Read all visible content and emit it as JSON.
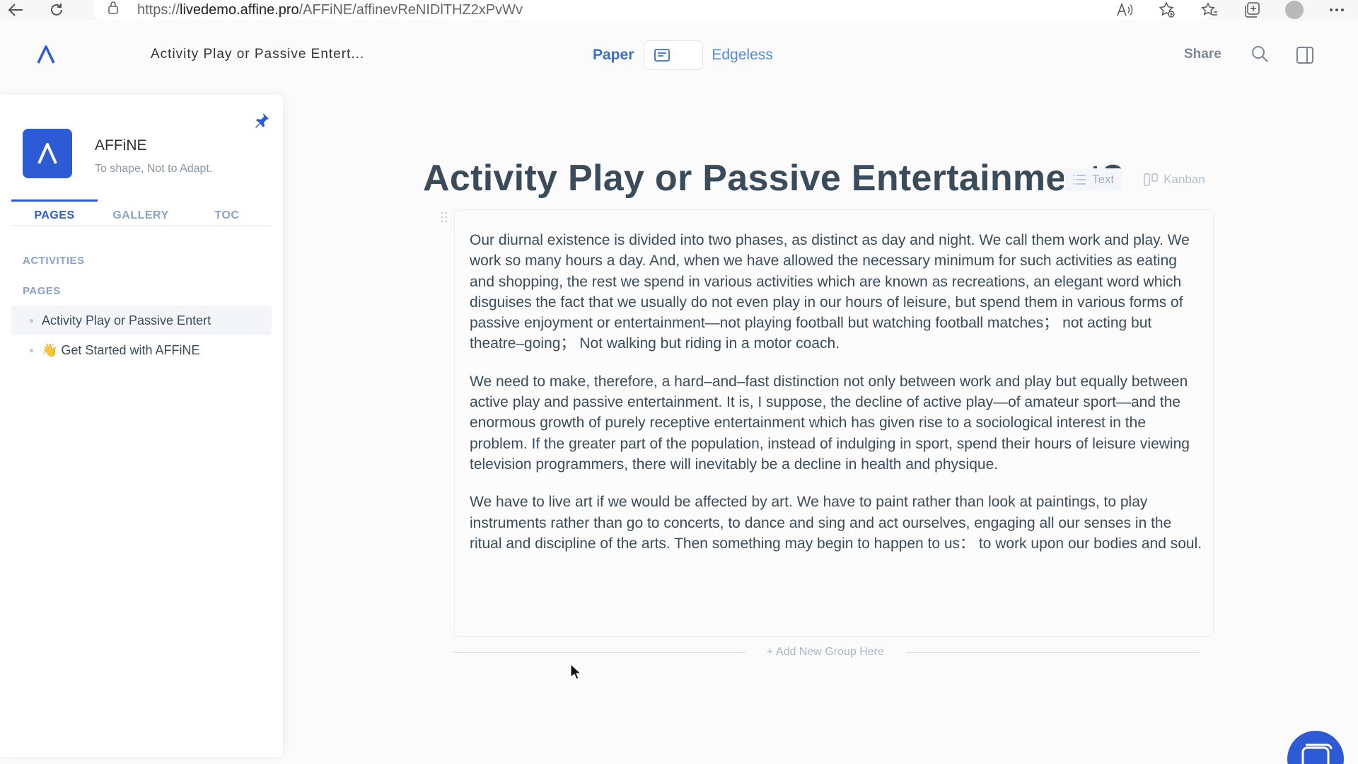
{
  "browser": {
    "url_prefix": "https://",
    "url_domain": "livedemo.affine.pro",
    "url_path": "/AFFiNE/affinevReNIDlTHZ2xPvWv"
  },
  "header": {
    "doc_title_short": "Activity Play or Passive Entert...",
    "mode_paper": "Paper",
    "mode_edgeless": "Edgeless",
    "share": "Share"
  },
  "sidebar": {
    "workspace_name": "AFFiNE",
    "workspace_tagline": "To shape, Not to Adapt.",
    "tabs": [
      {
        "label": "PAGES"
      },
      {
        "label": "GALLERY"
      },
      {
        "label": "TOC"
      }
    ],
    "section_activities": "ACTIVITIES",
    "section_pages": "PAGES",
    "pages": [
      {
        "label": "Activity Play or Passive Entert"
      },
      {
        "label": "👋 Get Started with AFFiNE"
      }
    ]
  },
  "document": {
    "title": "Activity Play or Passive Entertainment?",
    "view_text": "Text",
    "view_kanban": "Kanban",
    "paragraphs": [
      "Our diurnal existence is divided into two phases, as distinct as day and night. We call them work and play. We work so many hours a day. And, when we have allowed the necessary minimum for such activities as eating and shopping, the rest we spend in various activities which are known as recreations, an elegant word which disguises the fact that we usually do not even play in our hours of leisure, but spend them in various forms of passive enjoyment or entertainment—not playing football but watching football matches； not acting but theatre–going； Not walking but riding in a motor coach.",
      "We need to make, therefore, a hard–and–fast distinction not only between work and play but equally between active play and passive entertainment. It is, I suppose, the decline of active play—of amateur sport—and the enormous growth of purely receptive entertainment which has given rise to a sociological interest in the problem. If the greater part of the population, instead of indulging in sport, spend their hours of leisure viewing television programmers, there will inevitably be a decline in health and physique.",
      "We have to live art if we would be affected by art. We have to paint rather than look at paintings, to play instruments rather than go to concerts, to dance and sing and act ourselves, engaging all our senses in the ritual and discipline of the arts. Then something may begin to happen to us： to work upon our bodies and soul."
    ],
    "add_group": "+ Add New Group Here"
  },
  "colors": {
    "accent": "#2d5bd6",
    "text": "#3a4c5c"
  }
}
